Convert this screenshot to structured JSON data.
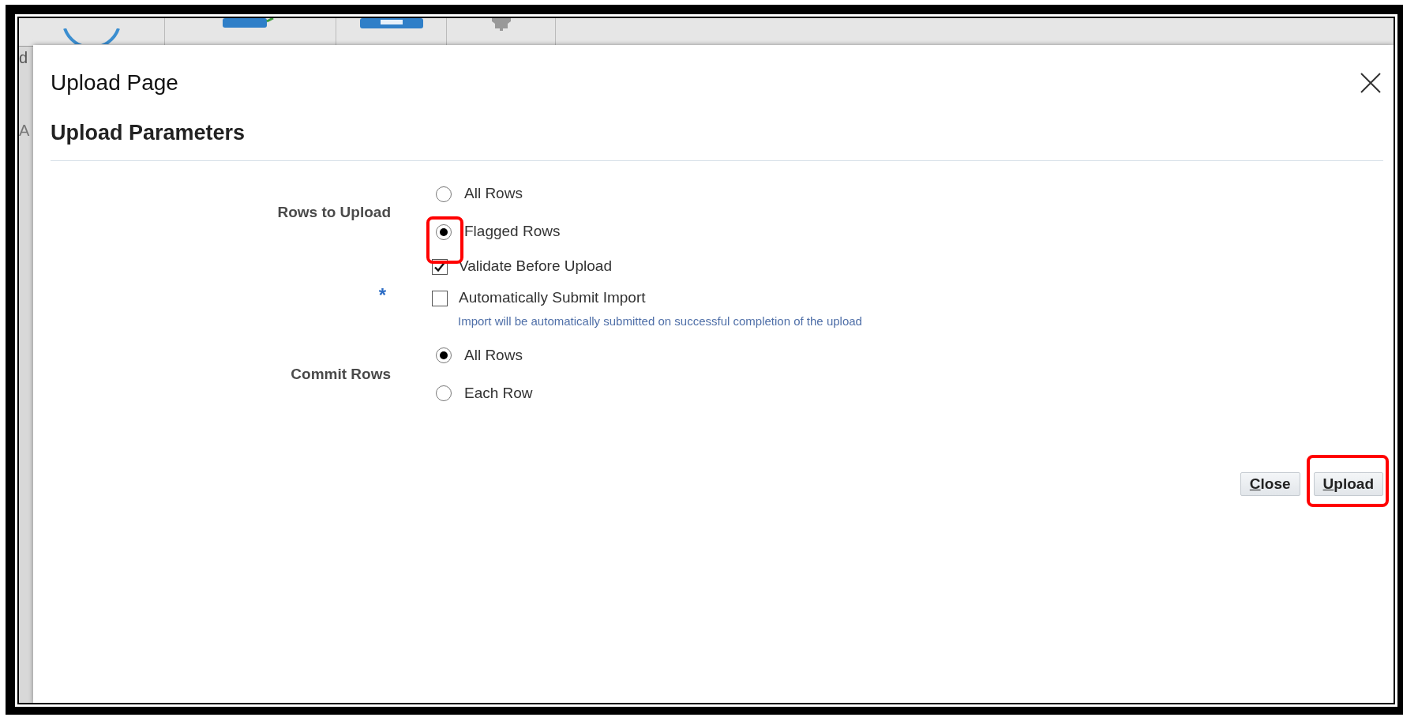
{
  "background": {
    "fragments": [
      "d",
      "A"
    ]
  },
  "dialog": {
    "title": "Upload Page",
    "section_title": "Upload Parameters",
    "fields": [
      {
        "kind": "radio_group",
        "label": "Rows to Upload",
        "options": [
          {
            "label": "All Rows",
            "selected": false,
            "highlighted": false
          },
          {
            "label": "Flagged Rows",
            "selected": true,
            "highlighted": true
          }
        ]
      },
      {
        "kind": "checkbox",
        "label": "Validate Before Upload",
        "checked": true
      },
      {
        "kind": "checkbox",
        "required_mark": "*",
        "label": "Automatically Submit Import",
        "checked": false,
        "hint": "Import will be automatically submitted on successful completion of the upload"
      },
      {
        "kind": "radio_group",
        "label": "Commit Rows",
        "options": [
          {
            "label": "All Rows",
            "selected": true,
            "highlighted": false
          },
          {
            "label": "Each Row",
            "selected": false,
            "highlighted": false
          }
        ]
      }
    ],
    "buttons": [
      {
        "label": "Close",
        "highlighted": false
      },
      {
        "label": "Upload",
        "highlighted": true
      }
    ]
  }
}
